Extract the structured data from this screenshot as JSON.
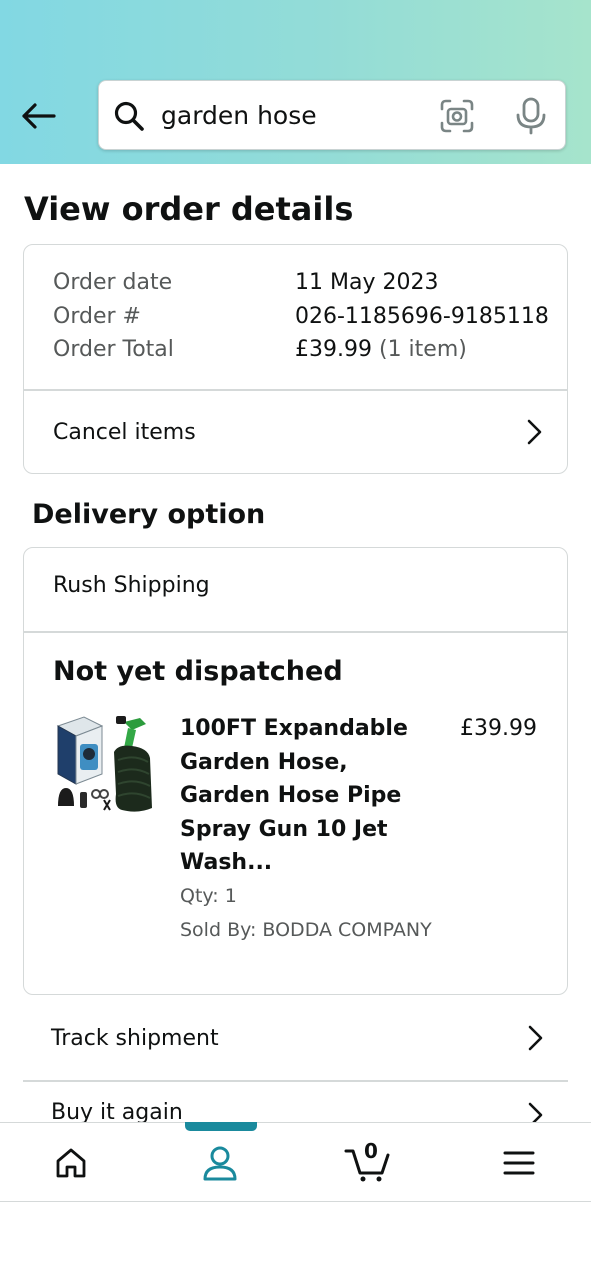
{
  "search": {
    "query": "garden hose"
  },
  "page": {
    "title": "View order details"
  },
  "order": {
    "rows": [
      {
        "label": "Order date",
        "value": "11 May 2023"
      },
      {
        "label": "Order #",
        "value": "026-1185696-9185118"
      },
      {
        "label": "Order Total",
        "value": "£39.99",
        "value_suffix": "(1 item)"
      }
    ],
    "cancel_label": "Cancel items"
  },
  "delivery": {
    "section_title": "Delivery option",
    "method": "Rush Shipping",
    "status": "Not yet dispatched",
    "product": {
      "title": "100FT Expandable Garden Hose, Garden Hose Pipe Spray Gun 10 Jet Wash...",
      "price": "£39.99",
      "qty": "Qty: 1",
      "seller": "Sold By: BODDA COMPANY"
    }
  },
  "actions": {
    "track_shipment": "Track shipment",
    "buy_it_again": "Buy it again"
  },
  "bottom_nav": {
    "items": [
      "home-icon",
      "account-icon",
      "cart-icon",
      "menu-icon"
    ],
    "active": "account-icon",
    "cart_count": "0"
  },
  "colors": {
    "accent": "#1a8a9d",
    "header_gradient_start": "#82d8e3",
    "header_gradient_end": "#a6e4cc",
    "border": "#d5d9d9",
    "muted_text": "#565959"
  }
}
